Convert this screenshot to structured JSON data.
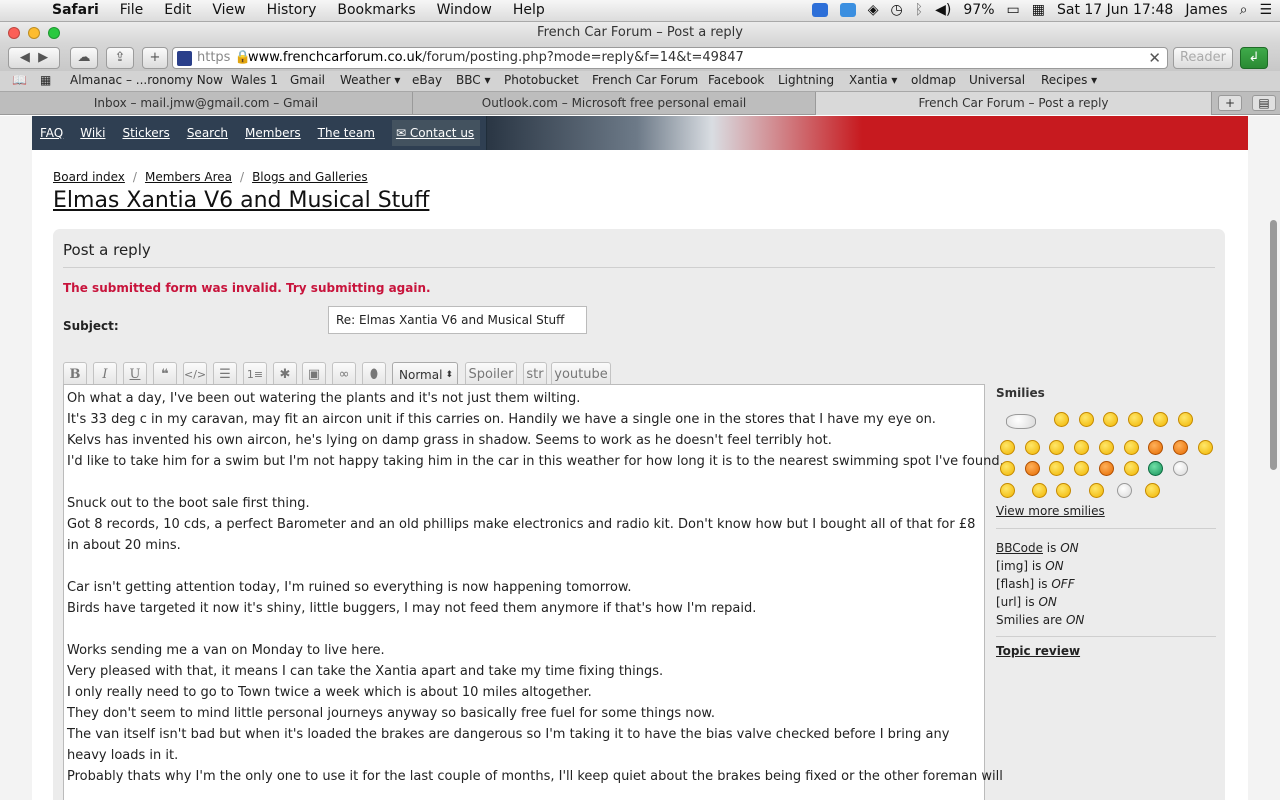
{
  "menubar": {
    "app": "Safari",
    "menus": [
      "File",
      "Edit",
      "View",
      "History",
      "Bookmarks",
      "Window",
      "Help"
    ],
    "battery": "97%",
    "datetime": "Sat 17 Jun  17:48",
    "user": "James"
  },
  "window": {
    "title": "French Car Forum – Post a reply"
  },
  "toolbar": {
    "url_scheme": "https",
    "url_host": "www.frenchcarforum.co.uk",
    "url_path": "/forum/posting.php?mode=reply&f=14&t=49847",
    "reader_label": "Reader"
  },
  "bookmarks": [
    "Almanac – ...ronomy Now",
    "Wales 1",
    "Gmail",
    "Weather ▾",
    "eBay",
    "BBC ▾",
    "Photobucket",
    "French Car Forum",
    "Facebook",
    "Lightning",
    "Xantia ▾",
    "oldmap",
    "Universal",
    "Recipes ▾"
  ],
  "tabs": [
    {
      "label": "Inbox – mail.jmw@gmail.com – Gmail"
    },
    {
      "label": "Outlook.com – Microsoft free personal email"
    },
    {
      "label": "French Car Forum – Post a reply"
    }
  ],
  "nav": {
    "faq": "FAQ",
    "wiki": "Wiki",
    "stickers": "Stickers",
    "search": "Search",
    "members": "Members",
    "team": "The team",
    "contact": "Contact us"
  },
  "breadcrumbs": [
    "Board index",
    "Members Area",
    "Blogs and Galleries"
  ],
  "topic_title": "Elmas Xantia V6 and Musical Stuff",
  "form": {
    "heading": "Post a reply",
    "error": "The submitted form was invalid. Try submitting again.",
    "subject_label": "Subject:",
    "subject_value": "Re: Elmas Xantia V6 and Musical Stuff",
    "font_size": "Normal",
    "spoiler": "Spoiler",
    "str": "str",
    "youtube": "youtube"
  },
  "message": [
    "Oh what a day, I've been out watering the plants and it's not just them wilting.",
    "It's 33 deg c in my caravan, may fit an aircon unit if this carries on.  Handily we have a single one in the stores that I have my eye on.",
    "Kelvs has invented his own aircon, he's lying on damp grass in shadow.  Seems to work as he doesn't feel terribly hot.",
    "I'd like to take him for a swim but I'm not happy taking him in the car in this weather for how long it is to the nearest swimming spot I've found.",
    "",
    "Snuck out to the boot sale first thing.",
    "Got 8 records, 10 cds, a perfect Barometer and an old phillips make electronics and radio kit.  Don't know how but I bought all of that for £8 in about 20 mins.",
    "",
    "Car isn't getting attention today, I'm ruined so everything is now happening tomorrow.",
    "Birds have targeted it now it's shiny, little buggers, I may not feed them anymore if that's how I'm repaid.",
    "",
    "Works sending me a van on Monday to live here.",
    "Very pleased with that, it means I can take the Xantia apart and take my time fixing things.",
    "I only really need to go to Town twice a week which is about 10 miles altogether.",
    "They don't seem to mind little personal journeys anyway so basically free fuel for some things now.",
    "The van itself isn't bad but when it's loaded the brakes are dangerous so I'm taking it to have the bias valve checked before I bring any heavy loads in it.",
    "Probably thats why I'm the only one to use it for the last couple of months, I'll keep quiet about the brakes being fixed or the other foreman will"
  ],
  "sidebar": {
    "smilies_heading": "Smilies",
    "view_more": "View more smilies",
    "bbcode_link": "BBCode",
    "bbcode_mid": " is ",
    "bbcode_state": "ON",
    "img_label": "[img] is ",
    "img_state": "ON",
    "flash_label": "[flash] is ",
    "flash_state": "OFF",
    "url_label": "[url] is ",
    "url_state": "ON",
    "smilies_label": "Smilies are ",
    "smilies_state": "ON",
    "topic_review": "Topic review"
  },
  "colors": {
    "error": "#c8143c",
    "banner_red": "#c71a1f",
    "nav_bg": "#2f3f52"
  }
}
